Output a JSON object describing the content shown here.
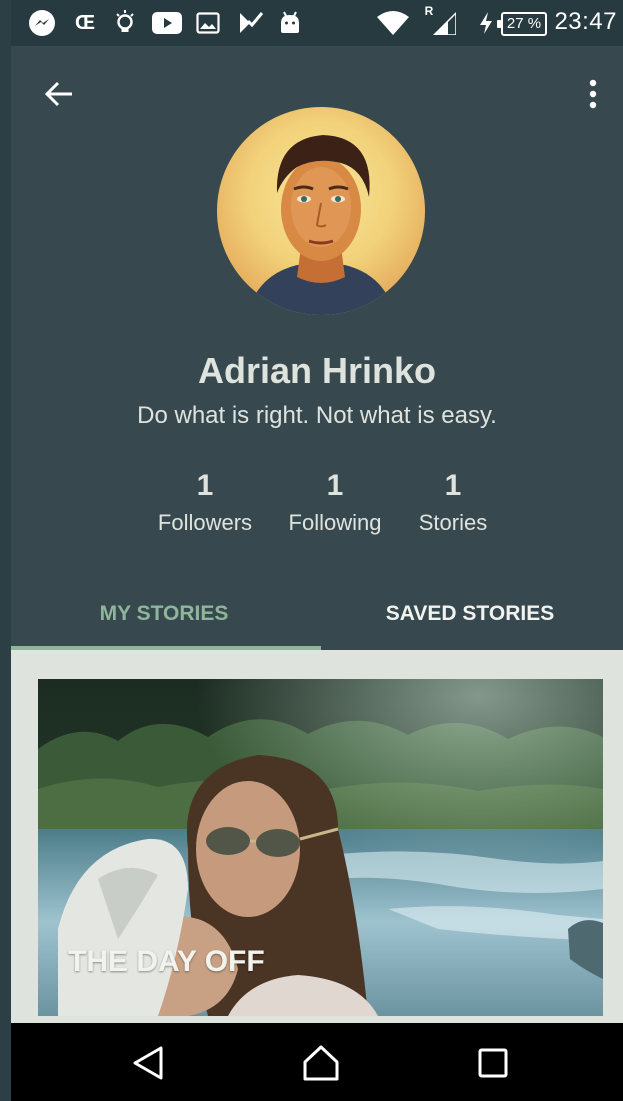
{
  "status_bar": {
    "icons": [
      "messenger-icon",
      "outlook-icon",
      "lightbulb-icon",
      "youtube-icon",
      "gallery-icon",
      "keep-icon",
      "android-icon",
      "wifi-icon",
      "signal-icon",
      "charging-icon"
    ],
    "roaming": "R",
    "battery": "27 %",
    "time": "23:47"
  },
  "header": {
    "back_icon": "arrow-back-icon",
    "more_icon": "more-vertical-icon"
  },
  "profile": {
    "name": "Adrian Hrinko",
    "bio": "Do what is right. Not what is easy.",
    "stats": [
      {
        "value": "1",
        "label": "Followers"
      },
      {
        "value": "1",
        "label": "Following"
      },
      {
        "value": "1",
        "label": "Stories"
      }
    ]
  },
  "tabs": [
    {
      "label": "MY STORIES",
      "active": true
    },
    {
      "label": "SAVED STORIES",
      "active": false
    }
  ],
  "stories": [
    {
      "title": "THE DAY OFF"
    }
  ],
  "nav_bar": {
    "icons": [
      "back-triangle-icon",
      "home-icon",
      "recents-icon"
    ]
  },
  "colors": {
    "header_bg": "#37494e",
    "status_bg": "#273a3f",
    "accent": "#8fb59b",
    "content_bg": "#dfe3de"
  }
}
